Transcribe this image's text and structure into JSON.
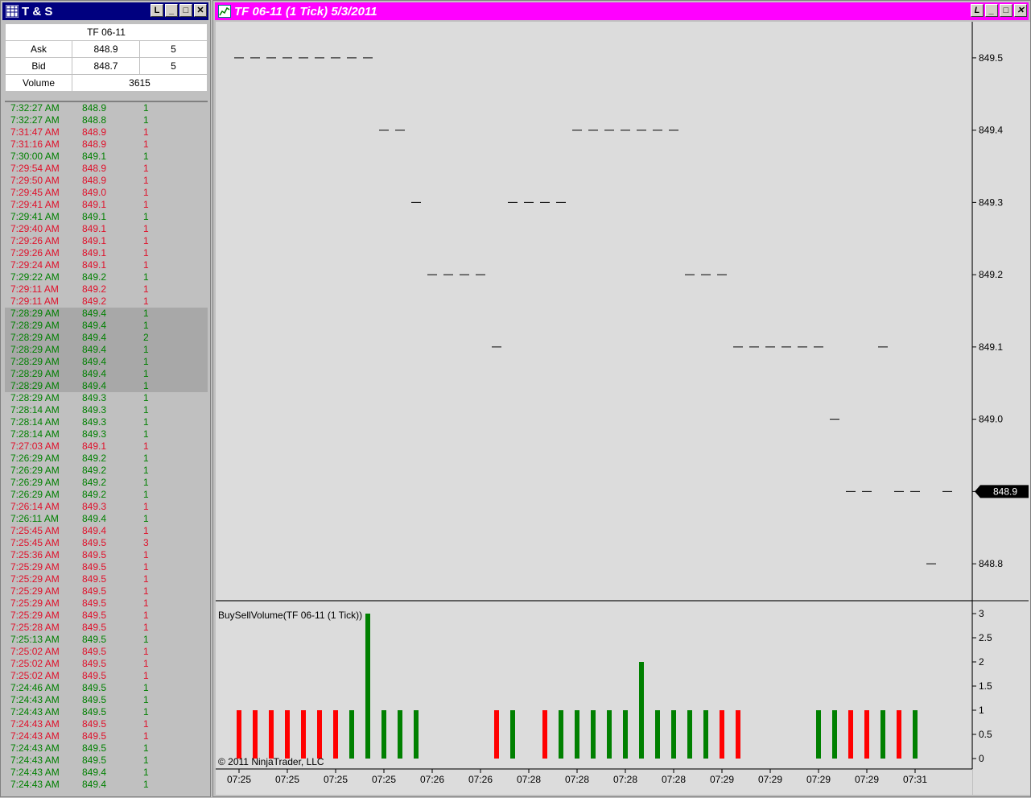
{
  "ts_window": {
    "title": "T & S",
    "buttons": [
      "L",
      "_",
      "□",
      "✕"
    ],
    "quote": {
      "instrument": "TF 06-11",
      "ask_label": "Ask",
      "ask_price": "848.9",
      "ask_size": "5",
      "bid_label": "Bid",
      "bid_price": "848.7",
      "bid_size": "5",
      "volume_label": "Volume",
      "volume": "3615"
    },
    "rows": [
      {
        "time": "7:32:27 AM",
        "price": "848.9",
        "size": "1",
        "side": "g"
      },
      {
        "time": "7:32:27 AM",
        "price": "848.8",
        "size": "1",
        "side": "g"
      },
      {
        "time": "7:31:47 AM",
        "price": "848.9",
        "size": "1",
        "side": "r"
      },
      {
        "time": "7:31:16 AM",
        "price": "848.9",
        "size": "1",
        "side": "r"
      },
      {
        "time": "7:30:00 AM",
        "price": "849.1",
        "size": "1",
        "side": "g"
      },
      {
        "time": "7:29:54 AM",
        "price": "848.9",
        "size": "1",
        "side": "r"
      },
      {
        "time": "7:29:50 AM",
        "price": "848.9",
        "size": "1",
        "side": "r"
      },
      {
        "time": "7:29:45 AM",
        "price": "849.0",
        "size": "1",
        "side": "r"
      },
      {
        "time": "7:29:41 AM",
        "price": "849.1",
        "size": "1",
        "side": "r"
      },
      {
        "time": "7:29:41 AM",
        "price": "849.1",
        "size": "1",
        "side": "g"
      },
      {
        "time": "7:29:40 AM",
        "price": "849.1",
        "size": "1",
        "side": "r"
      },
      {
        "time": "7:29:26 AM",
        "price": "849.1",
        "size": "1",
        "side": "r"
      },
      {
        "time": "7:29:26 AM",
        "price": "849.1",
        "size": "1",
        "side": "r"
      },
      {
        "time": "7:29:24 AM",
        "price": "849.1",
        "size": "1",
        "side": "r"
      },
      {
        "time": "7:29:22 AM",
        "price": "849.2",
        "size": "1",
        "side": "g"
      },
      {
        "time": "7:29:11 AM",
        "price": "849.2",
        "size": "1",
        "side": "r"
      },
      {
        "time": "7:29:11 AM",
        "price": "849.2",
        "size": "1",
        "side": "r"
      },
      {
        "time": "7:28:29 AM",
        "price": "849.4",
        "size": "1",
        "side": "g",
        "hl": true
      },
      {
        "time": "7:28:29 AM",
        "price": "849.4",
        "size": "1",
        "side": "g",
        "hl": true
      },
      {
        "time": "7:28:29 AM",
        "price": "849.4",
        "size": "2",
        "side": "g",
        "hl": true
      },
      {
        "time": "7:28:29 AM",
        "price": "849.4",
        "size": "1",
        "side": "g",
        "hl": true
      },
      {
        "time": "7:28:29 AM",
        "price": "849.4",
        "size": "1",
        "side": "g",
        "hl": true
      },
      {
        "time": "7:28:29 AM",
        "price": "849.4",
        "size": "1",
        "side": "g",
        "hl": true
      },
      {
        "time": "7:28:29 AM",
        "price": "849.4",
        "size": "1",
        "side": "g",
        "hl": true
      },
      {
        "time": "7:28:29 AM",
        "price": "849.3",
        "size": "1",
        "side": "g"
      },
      {
        "time": "7:28:14 AM",
        "price": "849.3",
        "size": "1",
        "side": "g"
      },
      {
        "time": "7:28:14 AM",
        "price": "849.3",
        "size": "1",
        "side": "g"
      },
      {
        "time": "7:28:14 AM",
        "price": "849.3",
        "size": "1",
        "side": "g"
      },
      {
        "time": "7:27:03 AM",
        "price": "849.1",
        "size": "1",
        "side": "r"
      },
      {
        "time": "7:26:29 AM",
        "price": "849.2",
        "size": "1",
        "side": "g"
      },
      {
        "time": "7:26:29 AM",
        "price": "849.2",
        "size": "1",
        "side": "g"
      },
      {
        "time": "7:26:29 AM",
        "price": "849.2",
        "size": "1",
        "side": "g"
      },
      {
        "time": "7:26:29 AM",
        "price": "849.2",
        "size": "1",
        "side": "g"
      },
      {
        "time": "7:26:14 AM",
        "price": "849.3",
        "size": "1",
        "side": "r"
      },
      {
        "time": "7:26:11 AM",
        "price": "849.4",
        "size": "1",
        "side": "g"
      },
      {
        "time": "7:25:45 AM",
        "price": "849.4",
        "size": "1",
        "side": "r"
      },
      {
        "time": "7:25:45 AM",
        "price": "849.5",
        "size": "3",
        "side": "r"
      },
      {
        "time": "7:25:36 AM",
        "price": "849.5",
        "size": "1",
        "side": "r"
      },
      {
        "time": "7:25:29 AM",
        "price": "849.5",
        "size": "1",
        "side": "r"
      },
      {
        "time": "7:25:29 AM",
        "price": "849.5",
        "size": "1",
        "side": "r"
      },
      {
        "time": "7:25:29 AM",
        "price": "849.5",
        "size": "1",
        "side": "r"
      },
      {
        "time": "7:25:29 AM",
        "price": "849.5",
        "size": "1",
        "side": "r"
      },
      {
        "time": "7:25:29 AM",
        "price": "849.5",
        "size": "1",
        "side": "r"
      },
      {
        "time": "7:25:28 AM",
        "price": "849.5",
        "size": "1",
        "side": "r"
      },
      {
        "time": "7:25:13 AM",
        "price": "849.5",
        "size": "1",
        "side": "g"
      },
      {
        "time": "7:25:02 AM",
        "price": "849.5",
        "size": "1",
        "side": "r"
      },
      {
        "time": "7:25:02 AM",
        "price": "849.5",
        "size": "1",
        "side": "r"
      },
      {
        "time": "7:25:02 AM",
        "price": "849.5",
        "size": "1",
        "side": "r"
      },
      {
        "time": "7:24:46 AM",
        "price": "849.5",
        "size": "1",
        "side": "g"
      },
      {
        "time": "7:24:43 AM",
        "price": "849.5",
        "size": "1",
        "side": "g"
      },
      {
        "time": "7:24:43 AM",
        "price": "849.5",
        "size": "1",
        "side": "g"
      },
      {
        "time": "7:24:43 AM",
        "price": "849.5",
        "size": "1",
        "side": "r"
      },
      {
        "time": "7:24:43 AM",
        "price": "849.5",
        "size": "1",
        "side": "r"
      },
      {
        "time": "7:24:43 AM",
        "price": "849.5",
        "size": "1",
        "side": "g"
      },
      {
        "time": "7:24:43 AM",
        "price": "849.5",
        "size": "1",
        "side": "g"
      },
      {
        "time": "7:24:43 AM",
        "price": "849.4",
        "size": "1",
        "side": "g"
      },
      {
        "time": "7:24:43 AM",
        "price": "849.4",
        "size": "1",
        "side": "g"
      }
    ]
  },
  "chart_window": {
    "title": "TF 06-11 (1 Tick)  5/3/2011",
    "buttons": [
      "L",
      "_",
      "□",
      "✕"
    ],
    "indicator_label": "BuySellVolume(TF 06-11 (1 Tick))",
    "copyright": "© 2011 NinjaTrader, LLC",
    "current_price": "848.9",
    "colors": {
      "buy": "#008000",
      "sell": "#ff0000",
      "background": "#dcdcdc",
      "titlebar": "#ff00ff"
    }
  },
  "chart_data": [
    {
      "type": "line",
      "title": "TF 06-11 (1 Tick)",
      "price_ticks": [
        "849.5",
        "849.4",
        "849.3",
        "849.2",
        "849.1",
        "849.0",
        "848.9",
        "848.8"
      ],
      "ylim": [
        848.75,
        849.55
      ],
      "series": [
        {
          "values": [
            849.5,
            849.5,
            849.5,
            849.5,
            849.5,
            849.5,
            849.5,
            849.5,
            849.5,
            849.4,
            849.4,
            849.3,
            849.2,
            849.2,
            849.2,
            849.2,
            849.1,
            849.3,
            849.3,
            849.3,
            849.3,
            849.4,
            849.4,
            849.4,
            849.4,
            849.4,
            849.4,
            849.4,
            849.2,
            849.2,
            849.2,
            849.1,
            849.1,
            849.1,
            849.1,
            849.1,
            849.1,
            849.0,
            848.9,
            848.9,
            849.1,
            848.9,
            848.9,
            848.8,
            848.9
          ]
        }
      ]
    },
    {
      "type": "bar",
      "title": "BuySellVolume(TF 06-11 (1 Tick))",
      "yticks": [
        "3",
        "2.5",
        "2",
        "1.5",
        "1",
        "0.5",
        "0"
      ],
      "ylim": [
        0,
        3
      ],
      "series": [
        {
          "name": "buy",
          "bars": [
            [
              7,
              1
            ],
            [
              8,
              3
            ],
            [
              9,
              1
            ],
            [
              10,
              1
            ],
            [
              11,
              1
            ],
            [
              17,
              1
            ],
            [
              20,
              1
            ],
            [
              21,
              1
            ],
            [
              22,
              1
            ],
            [
              23,
              1
            ],
            [
              24,
              1
            ],
            [
              25,
              2
            ],
            [
              26,
              1
            ],
            [
              27,
              1
            ],
            [
              28,
              1
            ],
            [
              29,
              1
            ],
            [
              36,
              1
            ],
            [
              37,
              1
            ],
            [
              40,
              1
            ],
            [
              42,
              1
            ]
          ]
        },
        {
          "name": "sell",
          "bars": [
            [
              0,
              1
            ],
            [
              1,
              1
            ],
            [
              2,
              1
            ],
            [
              3,
              1
            ],
            [
              4,
              1
            ],
            [
              5,
              1
            ],
            [
              6,
              1
            ],
            [
              16,
              1
            ],
            [
              19,
              1
            ],
            [
              30,
              1
            ],
            [
              31,
              1
            ],
            [
              38,
              1
            ],
            [
              39,
              1
            ],
            [
              41,
              1
            ]
          ]
        }
      ],
      "xtick_labels": [
        "07:25",
        "07:25",
        "07:25",
        "07:25",
        "07:26",
        "07:26",
        "07:28",
        "07:28",
        "07:28",
        "07:28",
        "07:29",
        "07:29",
        "07:29",
        "07:29",
        "07:31"
      ]
    }
  ]
}
